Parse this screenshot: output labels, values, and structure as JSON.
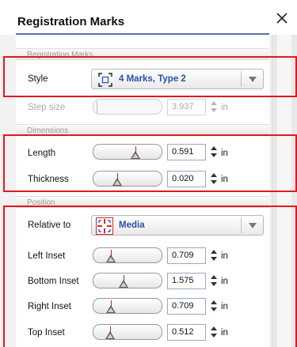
{
  "window": {
    "title": "Registration Marks"
  },
  "sections": {
    "registration": "Registration Marks",
    "dimensions": "Dimensions",
    "position": "Position"
  },
  "style": {
    "label": "Style",
    "value": "4 Marks, Type 2",
    "icon": "registration-4marks-icon"
  },
  "step_size": {
    "label": "Step size",
    "value": "3.937",
    "unit": "in",
    "slider_fraction": 0.02,
    "enabled": false
  },
  "length": {
    "label": "Length",
    "value": "0.591",
    "unit": "in",
    "slider_fraction": 0.62
  },
  "thickness": {
    "label": "Thickness",
    "value": "0.020",
    "unit": "in",
    "slider_fraction": 0.3
  },
  "relative_to": {
    "label": "Relative to",
    "value": "Media",
    "icon": "media-crosshair-icon"
  },
  "left_inset": {
    "label": "Left Inset",
    "value": "0.709",
    "unit": "in",
    "slider_fraction": 0.2
  },
  "bottom_inset": {
    "label": "Bottom Inset",
    "value": "1.575",
    "unit": "in",
    "slider_fraction": 0.42
  },
  "right_inset": {
    "label": "Right Inset",
    "value": "0.709",
    "unit": "in",
    "slider_fraction": 0.2
  },
  "top_inset": {
    "label": "Top Inset",
    "value": "0.512",
    "unit": "in",
    "slider_fraction": 0.18
  },
  "colors": {
    "highlight": "#e01a1a",
    "link": "#2a50a6",
    "marker": "#cc2020"
  }
}
